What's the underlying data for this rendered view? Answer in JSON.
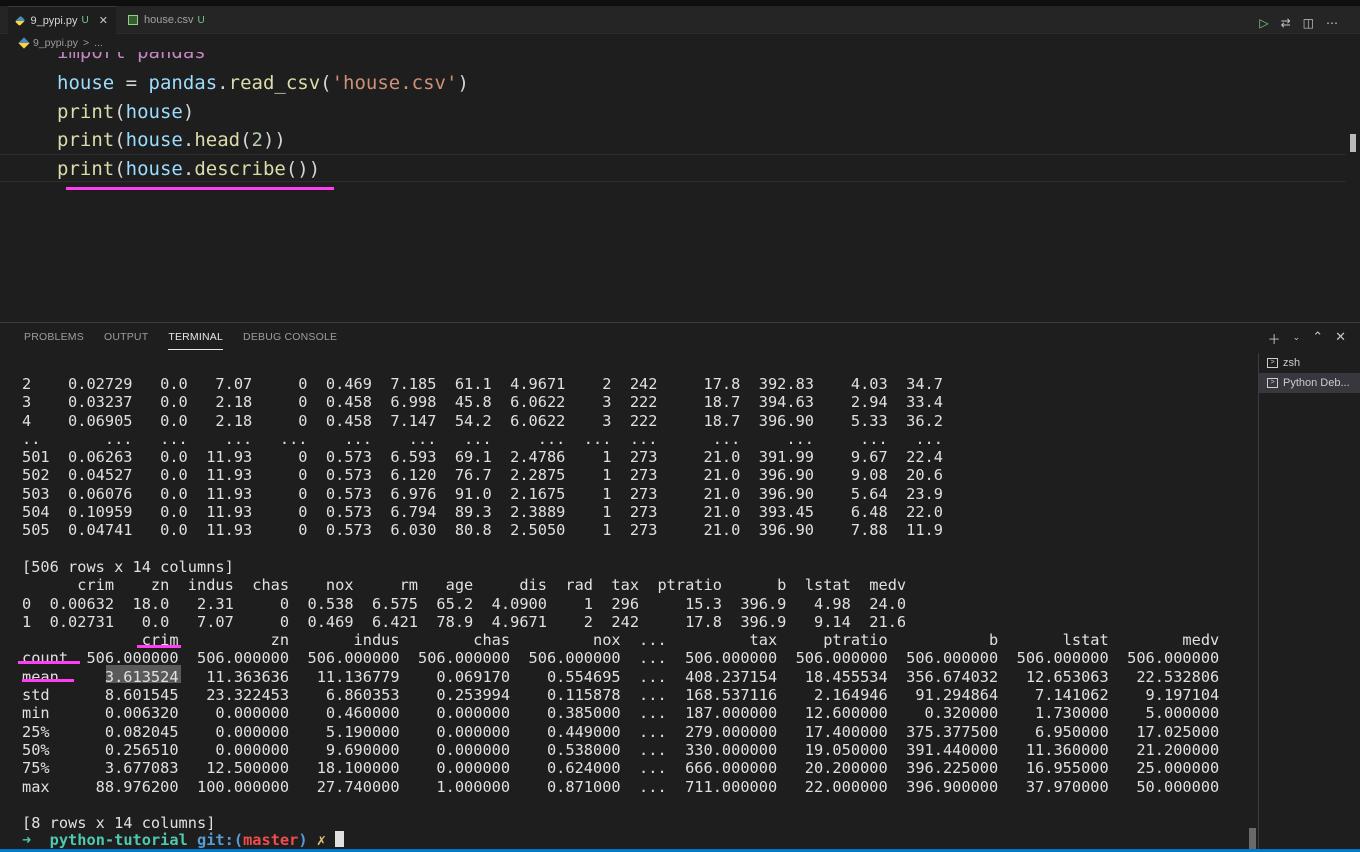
{
  "tabs": [
    {
      "label": "9_pypi.py",
      "modified": "U",
      "icon": "python-file-icon"
    },
    {
      "label": "house.csv",
      "modified": "U",
      "icon": "csv-file-icon"
    }
  ],
  "breadcrumb": {
    "file": "9_pypi.py",
    "sep": ">",
    "rest": "..."
  },
  "editor": {
    "lines": [
      {
        "t": "kw",
        "text": "import pandas"
      },
      {
        "parts": [
          [
            "var",
            "house"
          ],
          [
            "p",
            " = "
          ],
          [
            "var",
            "pandas"
          ],
          [
            "p",
            "."
          ],
          [
            "fn",
            "read_csv"
          ],
          [
            "p",
            "("
          ],
          [
            "str",
            "'house.csv'"
          ],
          [
            "p",
            ")"
          ]
        ]
      },
      {
        "parts": [
          [
            "fn",
            "print"
          ],
          [
            "p",
            "("
          ],
          [
            "var",
            "house"
          ],
          [
            "p",
            ")"
          ]
        ]
      },
      {
        "parts": [
          [
            "fn",
            "print"
          ],
          [
            "p",
            "("
          ],
          [
            "var",
            "house"
          ],
          [
            "p",
            "."
          ],
          [
            "fn",
            "head"
          ],
          [
            "p",
            "("
          ],
          [
            "num",
            "2"
          ],
          [
            "p",
            "))"
          ]
        ]
      },
      {
        "parts": [
          [
            "fn",
            "print"
          ],
          [
            "p",
            "("
          ],
          [
            "var",
            "house"
          ],
          [
            "p",
            "."
          ],
          [
            "fn",
            "describe"
          ],
          [
            "p",
            "())"
          ]
        ]
      }
    ]
  },
  "panel": {
    "tabs": [
      "PROBLEMS",
      "OUTPUT",
      "TERMINAL",
      "DEBUG CONSOLE"
    ],
    "active_tab": "TERMINAL",
    "terminals": [
      "zsh",
      "Python Deb..."
    ]
  },
  "terminal": {
    "lines": [
      "2    0.02729   0.0   7.07     0  0.469  7.185  61.1  4.9671    2  242     17.8  392.83    4.03  34.7",
      "3    0.03237   0.0   2.18     0  0.458  6.998  45.8  6.0622    3  222     18.7  394.63    2.94  33.4",
      "4    0.06905   0.0   2.18     0  0.458  7.147  54.2  6.0622    3  222     18.7  396.90    5.33  36.2",
      "..       ...   ...    ...   ...    ...    ...   ...     ...  ...  ...      ...     ...     ...   ...",
      "501  0.06263   0.0  11.93     0  0.573  6.593  69.1  2.4786    1  273     21.0  391.99    9.67  22.4",
      "502  0.04527   0.0  11.93     0  0.573  6.120  76.7  2.2875    1  273     21.0  396.90    9.08  20.6",
      "503  0.06076   0.0  11.93     0  0.573  6.976  91.0  2.1675    1  273     21.0  396.90    5.64  23.9",
      "504  0.10959   0.0  11.93     0  0.573  6.794  89.3  2.3889    1  273     21.0  393.45    6.48  22.0",
      "505  0.04741   0.0  11.93     0  0.573  6.030  80.8  2.5050    1  273     21.0  396.90    7.88  11.9",
      "",
      "[506 rows x 14 columns]",
      "      crim    zn  indus  chas    nox     rm   age     dis  rad  tax  ptratio      b  lstat  medv",
      "0  0.00632  18.0   2.31     0  0.538  6.575  65.2  4.0900    1  296     15.3  396.9   4.98  24.0",
      "1  0.02731   0.0   7.07     0  0.469  6.421  78.9  4.9671    2  242     17.8  396.9   9.14  21.6",
      "             crim          zn       indus        chas         nox  ...         tax     ptratio           b       lstat        medv",
      "count  506.000000  506.000000  506.000000  506.000000  506.000000  ...  506.000000  506.000000  506.000000  506.000000  506.000000",
      "mean     3.613524   11.363636   11.136779    0.069170    0.554695  ...  408.237154   18.455534  356.674032   12.653063   22.532806",
      "std      8.601545   23.322453    6.860353    0.253994    0.115878  ...  168.537116    2.164946   91.294864    7.141062    9.197104",
      "min      0.006320    0.000000    0.460000    0.000000    0.385000  ...  187.000000   12.600000    0.320000    1.730000    5.000000",
      "25%      0.082045    0.000000    5.190000    0.000000    0.449000  ...  279.000000   17.400000  375.377500    6.950000   17.025000",
      "50%      0.256510    0.000000    9.690000    0.000000    0.538000  ...  330.000000   19.050000  391.440000   11.360000   21.200000",
      "75%      3.677083   12.500000   18.100000    0.000000    0.624000  ...  666.000000   20.200000  396.225000   16.955000   25.000000",
      "max     88.976200  100.000000   27.740000    1.000000    0.871000  ...  711.000000   22.000000  396.900000   37.970000   50.000000",
      "",
      "[8 rows x 14 columns]"
    ],
    "prompt": {
      "arrow": "➜",
      "dir": "python-tutorial",
      "git_label": "git:(",
      "branch": "master",
      "git_close": ")",
      "dirty": "✗"
    }
  }
}
